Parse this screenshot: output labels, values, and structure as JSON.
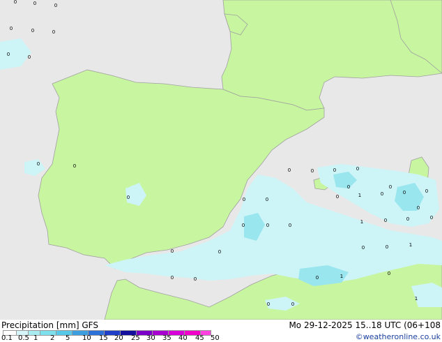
{
  "colors": {
    "sea": "#e8e8e8",
    "land": "#c8f5a0",
    "coast": "#a0a0a0",
    "precip_light": "#cdf5f8",
    "precip_mid": "#9ae6ee",
    "precip_strong": "#6cd6e6"
  },
  "footer": {
    "title": "Precipitation [mm]  GFS",
    "time": "Mo 29-12-2025 15..18 UTC (06+108",
    "credit": "©weatheronline.co.uk"
  },
  "legend": {
    "ticks": [
      "0.1",
      "0.5",
      "1",
      "2",
      "5",
      "10",
      "15",
      "20",
      "25",
      "30",
      "35",
      "40",
      "45",
      "50"
    ],
    "colors": [
      "#fefefe",
      "#d5f5f8",
      "#a8ecf2",
      "#7ee0ec",
      "#58c8e8",
      "#3d9fe0",
      "#2d70d8",
      "#1f3fc8",
      "#13109e",
      "#7b00c8",
      "#a800d0",
      "#d800d8",
      "#f000c8",
      "#ff40e0"
    ]
  },
  "map_labels": [
    {
      "text": "0"
    },
    {
      "text": "0"
    },
    {
      "text": "0"
    },
    {
      "text": "0"
    },
    {
      "text": "0"
    },
    {
      "text": "0"
    },
    {
      "text": "0"
    },
    {
      "text": "0"
    },
    {
      "text": "0"
    },
    {
      "text": "0"
    },
    {
      "text": "0"
    },
    {
      "text": "0"
    },
    {
      "text": "0"
    },
    {
      "text": "0"
    },
    {
      "text": "0"
    },
    {
      "text": "0"
    },
    {
      "text": "0"
    },
    {
      "text": "0"
    },
    {
      "text": "0"
    },
    {
      "text": "1"
    },
    {
      "text": "0"
    },
    {
      "text": "0"
    },
    {
      "text": "0"
    },
    {
      "text": "0"
    },
    {
      "text": "0"
    },
    {
      "text": "0"
    },
    {
      "text": "1"
    },
    {
      "text": "0"
    },
    {
      "text": "0"
    },
    {
      "text": "0"
    },
    {
      "text": "0"
    },
    {
      "text": "0"
    },
    {
      "text": "0"
    },
    {
      "text": "1"
    },
    {
      "text": "0"
    },
    {
      "text": "0"
    },
    {
      "text": "0"
    },
    {
      "text": "1"
    },
    {
      "text": "0"
    },
    {
      "text": "0"
    },
    {
      "text": "0"
    },
    {
      "text": "1"
    },
    {
      "text": "0"
    },
    {
      "text": "0"
    },
    {
      "text": "0"
    }
  ]
}
